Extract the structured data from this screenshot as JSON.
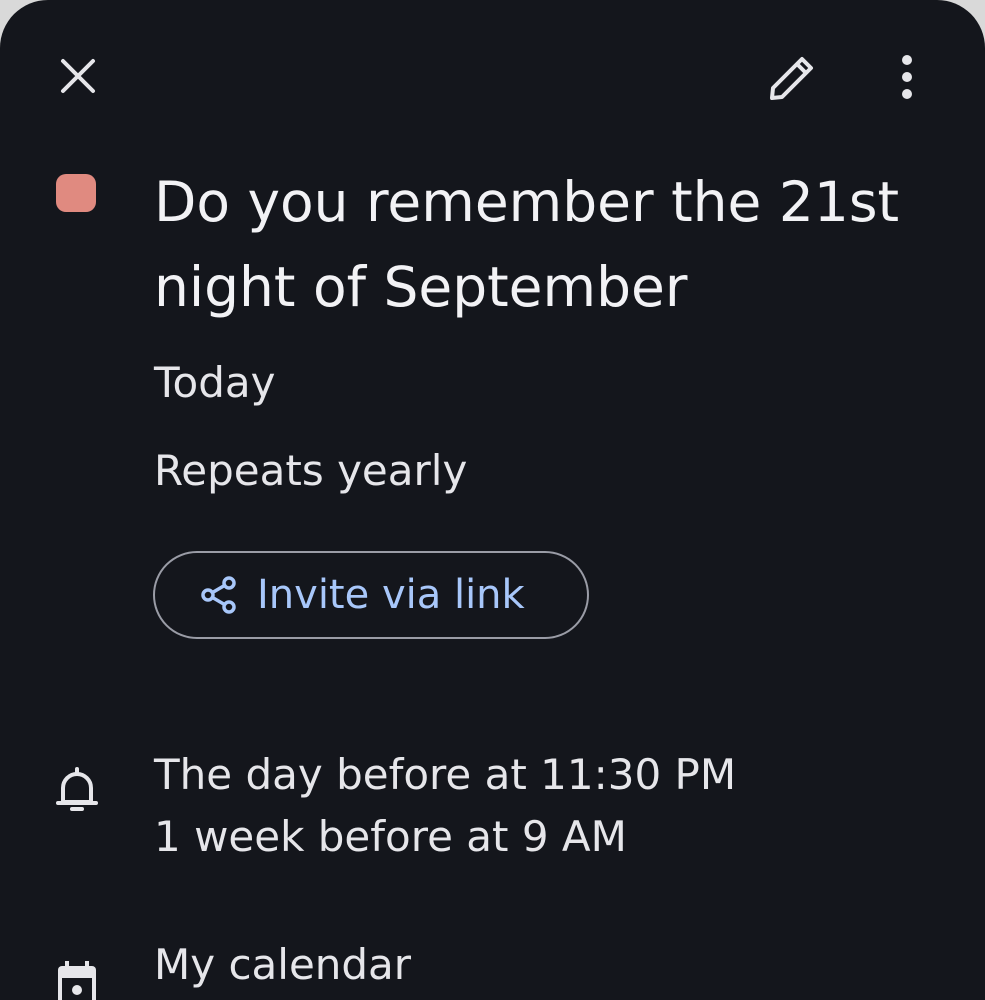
{
  "toolbar": {
    "close_icon": "close-icon",
    "edit_icon": "pencil-icon",
    "more_icon": "more-vert-icon"
  },
  "event": {
    "color": "#e08a80",
    "title": "Do you remember the 21st night of September",
    "date": "Today",
    "recurrence": "Repeats yearly"
  },
  "invite": {
    "label": "Invite via link",
    "icon": "share-icon",
    "color": "#a8c7fa"
  },
  "reminders": {
    "icon": "bell-icon",
    "items": [
      "The day before at 11:30 PM",
      "1 week before at 9 AM"
    ]
  },
  "calendar": {
    "icon": "calendar-icon",
    "name": "My calendar"
  }
}
